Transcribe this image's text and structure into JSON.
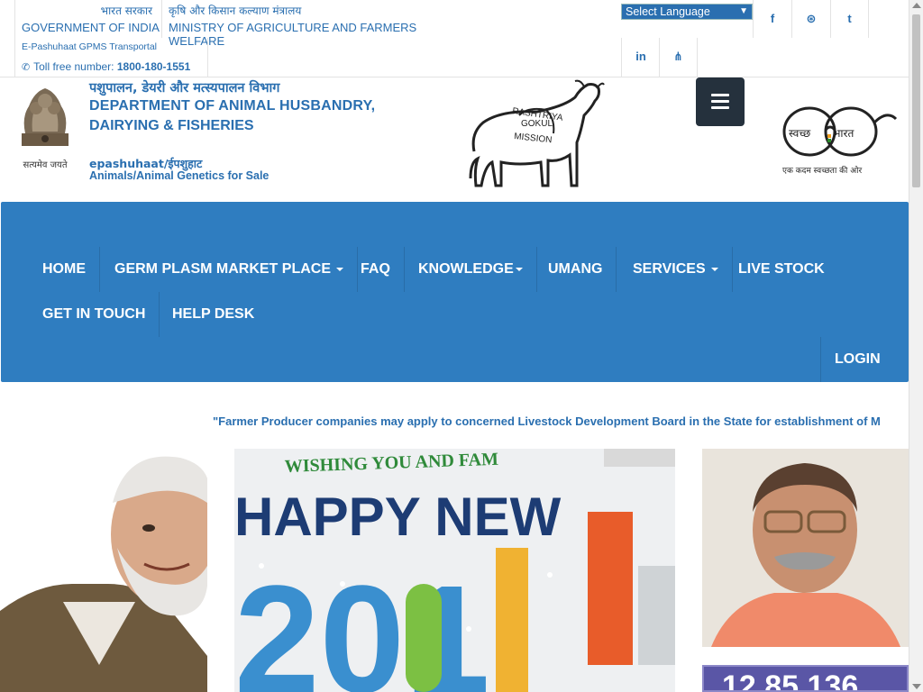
{
  "top": {
    "gov_hindi": "भारत सरकार",
    "gov_eng": "GOVERNMENT OF INDIA",
    "ministry_hindi": "कृषि और किसान कल्याण मंत्रालय",
    "ministry_eng": "MINISTRY OF AGRICULTURE AND FARMERS WELFARE",
    "portal_name": "E-Pashuhaat GPMS Transportal",
    "tollfree_label": "Toll free number:",
    "tollfree_number": "1800-180-1551",
    "language_select": "Select Language",
    "social": [
      "f",
      "⊛",
      "t",
      "in",
      "⋔"
    ]
  },
  "header": {
    "emblem_motto": "सत्यमेव जयते",
    "dept_hindi": "पशुपालन, डेयरी और मत्स्यपालन विभाग",
    "dept_eng_line1": "DEPARTMENT OF ANIMAL HUSBANDRY,",
    "dept_eng_line2": "DAIRYING & FISHERIES",
    "tagline_1": "epashuhaat/ईपशुहाट",
    "tagline_2": "Animals/Animal Genetics for Sale",
    "rgm_lines": [
      "RASHTRIYA",
      "GOKUL",
      "MISSION"
    ],
    "swachh_words": [
      "स्वच्छ",
      "भारत"
    ],
    "swachh_tagline": "एक कदम स्वच्छता की ओर"
  },
  "nav": {
    "home": "HOME",
    "germplasm": "GERM PLASM MARKET PLACE",
    "faq": "FAQ",
    "knowledge": "KNOWLEDGE",
    "umang": "UMANG",
    "services": "SERVICES",
    "livestock": "LIVE STOCK",
    "contact": "GET IN TOUCH",
    "helpdesk": "HELP DESK",
    "login": "LOGIN"
  },
  "marquee": "\"Farmer Producer companies may apply to concerned Livestock Development Board in the State for establishment of M",
  "banner": {
    "greeting": "WISHING YOU AND FAM",
    "headline": "HAPPY NEW",
    "year": "201"
  },
  "counter": "12,85,136",
  "colors": {
    "primary": "#2a6fb0",
    "nav_bg": "#2f7dc0",
    "hamburger_bg": "#25313d",
    "counter_bg": "#5a56a6"
  }
}
